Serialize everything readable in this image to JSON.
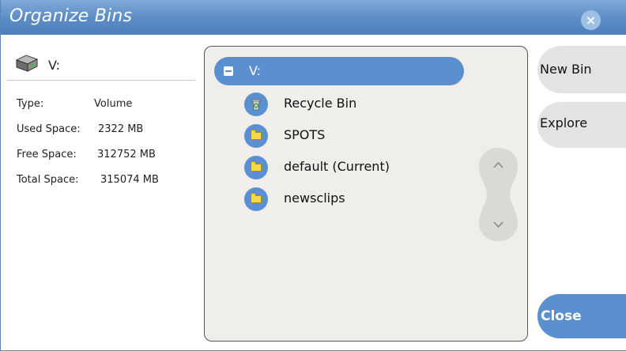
{
  "window": {
    "title": "Organize Bins",
    "close_icon": "×"
  },
  "drive": {
    "label": "V:",
    "icon": "drive-icon",
    "info": [
      {
        "key": "Type:",
        "value": "Volume"
      },
      {
        "key": "Used Space:",
        "value": "2322 MB"
      },
      {
        "key": "Free Space:",
        "value": "312752 MB"
      },
      {
        "key": "Total Space:",
        "value": "315074 MB"
      }
    ]
  },
  "tree": {
    "root": {
      "label": "V:",
      "icon": "collapse-icon"
    },
    "items": [
      {
        "label": "Recycle Bin",
        "icon": "recycle-bin-icon"
      },
      {
        "label": "SPOTS",
        "icon": "folder-icon"
      },
      {
        "label": "default (Current)",
        "icon": "folder-icon"
      },
      {
        "label": "newsclips",
        "icon": "folder-icon"
      }
    ]
  },
  "buttons": {
    "new_bin": "New Bin",
    "explore": "Explore",
    "close": "Close"
  },
  "colors": {
    "title_bar": "#5c8cc6",
    "accent": "#5b90d0",
    "panel_bg": "#efeeeb",
    "button_bg": "#e3e3e3"
  }
}
